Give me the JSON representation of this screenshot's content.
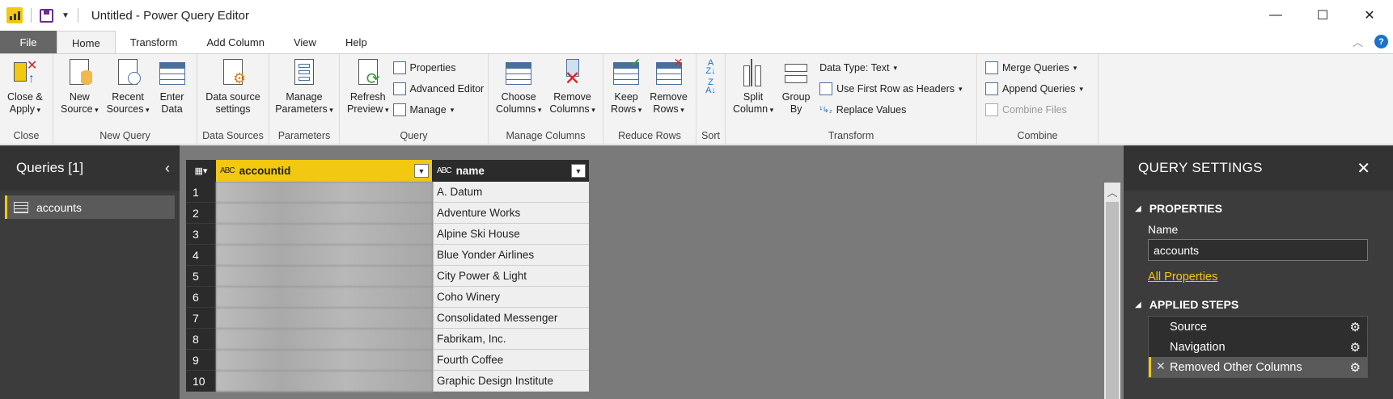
{
  "window": {
    "title": "Untitled - Power Query Editor",
    "minimize": "—",
    "maximize": "☐",
    "close": "✕"
  },
  "tabs": {
    "file": "File",
    "items": [
      "Home",
      "Transform",
      "Add Column",
      "View",
      "Help"
    ],
    "active": "Home",
    "help": "?"
  },
  "ribbon": {
    "close": {
      "label": "Close",
      "close_apply": "Close &\nApply"
    },
    "new_query": {
      "label": "New Query",
      "new_source": "New\nSource",
      "recent_sources": "Recent\nSources",
      "enter_data": "Enter\nData"
    },
    "data_sources": {
      "label": "Data Sources",
      "settings": "Data source\nsettings"
    },
    "parameters": {
      "label": "Parameters",
      "manage": "Manage\nParameters"
    },
    "query": {
      "label": "Query",
      "refresh": "Refresh\nPreview",
      "properties": "Properties",
      "advanced_editor": "Advanced Editor",
      "manage": "Manage"
    },
    "manage_columns": {
      "label": "Manage Columns",
      "choose": "Choose\nColumns",
      "remove": "Remove\nColumns"
    },
    "reduce_rows": {
      "label": "Reduce Rows",
      "keep": "Keep\nRows",
      "remove": "Remove\nRows"
    },
    "sort": {
      "label": "Sort"
    },
    "transform": {
      "label": "Transform",
      "split": "Split\nColumn",
      "group_by": "Group\nBy",
      "data_type": "Data Type: Text",
      "first_row": "Use First Row as Headers",
      "replace": "Replace Values"
    },
    "combine": {
      "label": "Combine",
      "merge": "Merge Queries",
      "append": "Append Queries",
      "combine_files": "Combine Files"
    }
  },
  "queries_pane": {
    "title": "Queries [1]",
    "items": [
      "accounts"
    ]
  },
  "grid": {
    "columns": [
      {
        "type": "ABC",
        "name": "accountid"
      },
      {
        "type": "ABC",
        "name": "name"
      }
    ],
    "rows": [
      {
        "n": "1",
        "name": "A. Datum"
      },
      {
        "n": "2",
        "name": "Adventure Works"
      },
      {
        "n": "3",
        "name": "Alpine Ski House"
      },
      {
        "n": "4",
        "name": "Blue Yonder Airlines"
      },
      {
        "n": "5",
        "name": "City Power & Light"
      },
      {
        "n": "6",
        "name": "Coho Winery"
      },
      {
        "n": "7",
        "name": "Consolidated Messenger"
      },
      {
        "n": "8",
        "name": "Fabrikam, Inc."
      },
      {
        "n": "9",
        "name": "Fourth Coffee"
      },
      {
        "n": "10",
        "name": "Graphic Design Institute"
      }
    ]
  },
  "settings_pane": {
    "title": "QUERY SETTINGS",
    "properties_title": "PROPERTIES",
    "name_label": "Name",
    "name_value": "accounts",
    "all_properties": "All Properties",
    "applied_steps_title": "APPLIED STEPS",
    "steps": [
      "Source",
      "Navigation",
      "Removed Other Columns"
    ]
  },
  "colors": {
    "accent": "#f2c811",
    "dark_pane": "#3c3c3c",
    "grid_bg": "#7a7a7a"
  }
}
